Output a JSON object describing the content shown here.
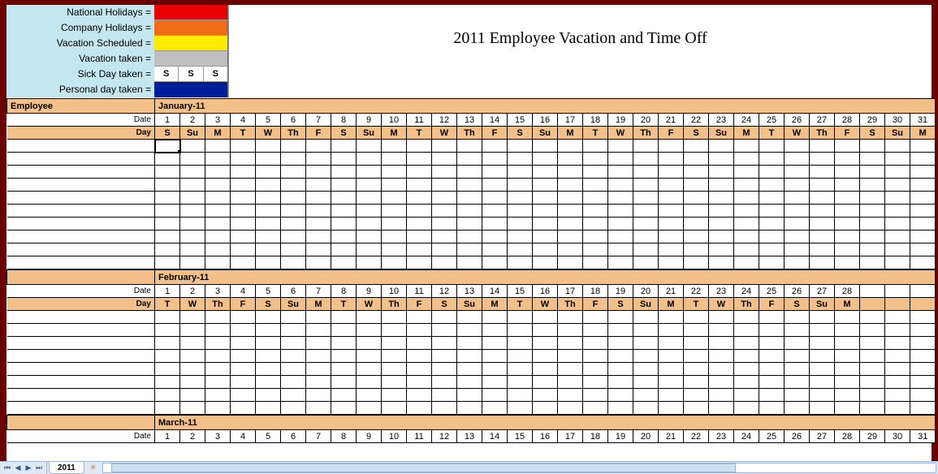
{
  "title": "2011 Employee Vacation and Time Off",
  "legend": {
    "items": [
      {
        "label": "National Holidays =",
        "swatch": "sw-red"
      },
      {
        "label": "Company Holidays =",
        "swatch": "sw-orange"
      },
      {
        "label": "Vacation Scheduled =",
        "swatch": "sw-yellow"
      },
      {
        "label": "Vacation taken =",
        "swatch": "sw-silver"
      },
      {
        "label": "Sick Day taken =",
        "swatch": "sw-white",
        "marks": [
          "S",
          "S",
          "S"
        ]
      },
      {
        "label": "Personal day taken =",
        "swatch": "sw-navy"
      }
    ]
  },
  "employee_header": "Employee",
  "row_labels": {
    "date": "Date",
    "day": "Day"
  },
  "months": [
    {
      "name": "January-11",
      "dates": [
        1,
        2,
        3,
        4,
        5,
        6,
        7,
        8,
        9,
        10,
        11,
        12,
        13,
        14,
        15,
        16,
        17,
        18,
        19,
        20,
        21,
        22,
        23,
        24,
        25,
        26,
        27,
        28,
        29,
        30,
        31
      ],
      "days": [
        "S",
        "Su",
        "M",
        "T",
        "W",
        "Th",
        "F",
        "S",
        "Su",
        "M",
        "T",
        "W",
        "Th",
        "F",
        "S",
        "Su",
        "M",
        "T",
        "W",
        "Th",
        "F",
        "S",
        "Su",
        "M",
        "T",
        "W",
        "Th",
        "F",
        "S",
        "Su",
        "M"
      ],
      "rows": 10,
      "show_employee_header": true,
      "show_days": true,
      "show_rows": true
    },
    {
      "name": "February-11",
      "dates": [
        1,
        2,
        3,
        4,
        5,
        6,
        7,
        8,
        9,
        10,
        11,
        12,
        13,
        14,
        15,
        16,
        17,
        18,
        19,
        20,
        21,
        22,
        23,
        24,
        25,
        26,
        27,
        28,
        "",
        "",
        ""
      ],
      "days": [
        "T",
        "W",
        "Th",
        "F",
        "S",
        "Su",
        "M",
        "T",
        "W",
        "Th",
        "F",
        "S",
        "Su",
        "M",
        "T",
        "W",
        "Th",
        "F",
        "S",
        "Su",
        "M",
        "T",
        "W",
        "Th",
        "F",
        "S",
        "Su",
        "M",
        "",
        "",
        ""
      ],
      "rows": 8,
      "show_employee_header": false,
      "show_days": true,
      "show_rows": true
    },
    {
      "name": "March-11",
      "dates": [
        1,
        2,
        3,
        4,
        5,
        6,
        7,
        8,
        9,
        10,
        11,
        12,
        13,
        14,
        15,
        16,
        17,
        18,
        19,
        20,
        21,
        22,
        23,
        24,
        25,
        26,
        27,
        28,
        29,
        30,
        31
      ],
      "days": [],
      "rows": 0,
      "show_employee_header": false,
      "show_days": false,
      "show_rows": false
    }
  ],
  "sheet_tab": "2011",
  "selected_cell": {
    "month_index": 0,
    "kind": "blank",
    "row": 0,
    "col": 0
  }
}
